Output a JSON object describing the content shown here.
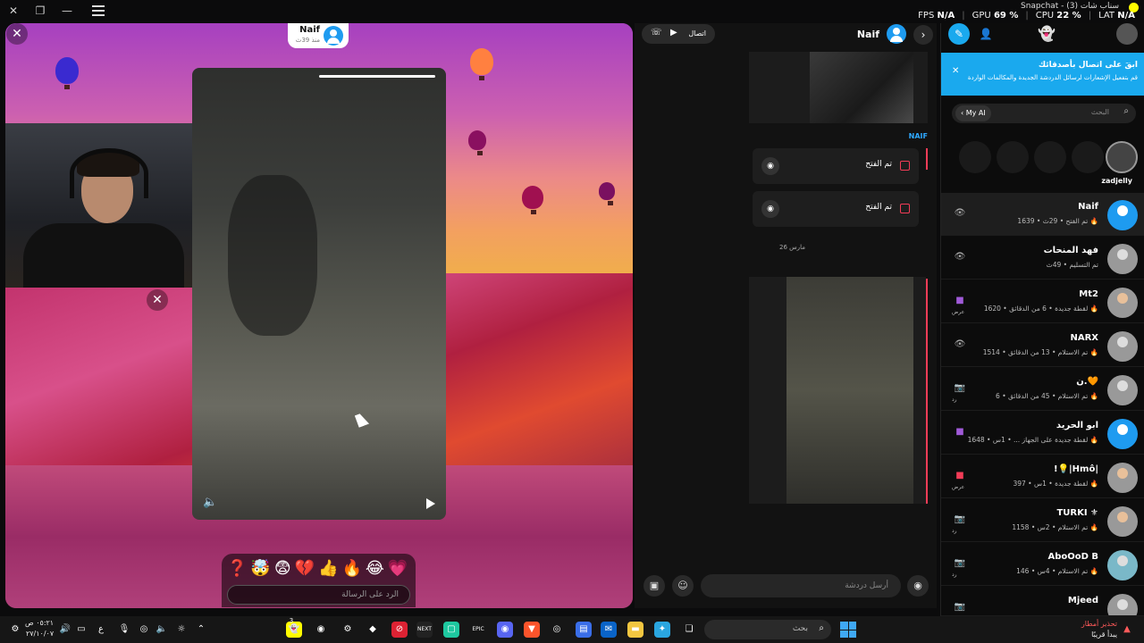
{
  "window": {
    "title": "Snapchat - (3) سناب شات",
    "stats": {
      "fps_label": "FPS",
      "fps": "N/A",
      "gpu_label": "GPU",
      "gpu": "69 %",
      "cpu_label": "CPU",
      "cpu": "22 %",
      "lat_label": "LAT",
      "lat": "N/A"
    }
  },
  "story": {
    "sender_name": "Naif",
    "sender_time": "منذ 39ث",
    "reply_placeholder": "الرد على الرسالة",
    "reactions": [
      "❓",
      "🤯",
      "😨",
      "💔",
      "👍",
      "🔥",
      "😂",
      "💗"
    ]
  },
  "chat": {
    "name": "Naif",
    "call_label": "اتصال",
    "sender_label": "NAIF",
    "opened_1": "تم الفتح",
    "opened_2": "تم الفتح",
    "date_label": "26 مارس",
    "input_placeholder": "أرسل دردشة"
  },
  "friends": {
    "banner_title": "ابقَ على اتصال بأصدقائك",
    "banner_sub": "قم بتفعيل الإشعارات لرسائل الدردشة الجديدة والمكالمات الواردة",
    "search_placeholder": "البحث",
    "my_ai": "My AI",
    "story_user": "zadjelly",
    "list": [
      {
        "name": "Naif",
        "status": "تم الفتح • 29ث • 1639 🔥",
        "left": "👁",
        "left_sub": ""
      },
      {
        "name": "فهد المنحات",
        "status": "تم التسليم • 49ث",
        "left": "👁",
        "left_sub": ""
      },
      {
        "name": "Mt2",
        "status": "لقطة جديدة • 6 من الدقائق • 1620 🔥",
        "left": "■",
        "left_sub": "عرض"
      },
      {
        "name": "NARX",
        "status": "تم الاستلام • 13 من الدقائق • 1514 🔥",
        "left": "👁",
        "left_sub": ""
      },
      {
        "name": "ن.🧡",
        "status": "تم الاستلام • 45 من الدقائق • 6 🔥",
        "left": "📷",
        "left_sub": "رد"
      },
      {
        "name": "ابو الحريد",
        "status": "لقطة جديدة على الجهاز ... • 1س • 1648 🔥",
        "left": "■",
        "left_sub": ""
      },
      {
        "name": "!💡|Hmô|",
        "status": "لقطة جديدة • 1س • 397 🔥",
        "left": "■",
        "left_sub": "عرض"
      },
      {
        "name": "TURKI ⚜",
        "status": "تم الاستلام • 2س • 1158 🔥",
        "left": "📷",
        "left_sub": "رد"
      },
      {
        "name": "AboOoD B",
        "status": "تم الاستلام • 4س • 146 🔥",
        "left": "📷",
        "left_sub": "رد"
      },
      {
        "name": "Mjeed",
        "status": "",
        "left": "📷",
        "left_sub": ""
      }
    ]
  },
  "taskbar": {
    "search_placeholder": "بحث",
    "time": "٠٥:٢١ ص",
    "date": "٢٧/١٠/٠٧",
    "lang": "ع",
    "weather_title": "تحذير أمطار",
    "weather_sub": "يبدأ قريبًا",
    "badge": "3"
  }
}
